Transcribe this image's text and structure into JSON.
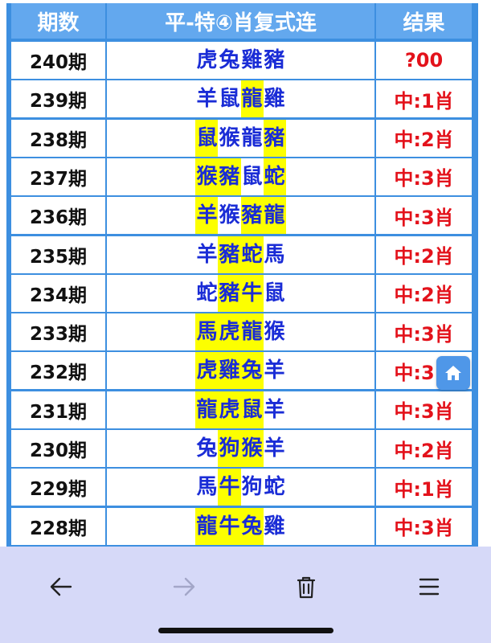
{
  "header": {
    "col_period": "期数",
    "col_zodiac": "平-特④肖复式连",
    "col_result": "结果"
  },
  "rows": [
    {
      "period": "240期",
      "zodiac": [
        "虎",
        "兔",
        "雞",
        "豬"
      ],
      "highlight": [
        false,
        false,
        false,
        false
      ],
      "result": "?00"
    },
    {
      "period": "239期",
      "zodiac": [
        "羊",
        "鼠",
        "龍",
        "雞"
      ],
      "highlight": [
        false,
        false,
        true,
        false
      ],
      "result": "中:1肖"
    },
    {
      "period": "238期",
      "zodiac": [
        "鼠",
        "猴",
        "龍",
        "豬"
      ],
      "highlight": [
        true,
        false,
        false,
        true
      ],
      "result": "中:2肖"
    },
    {
      "period": "237期",
      "zodiac": [
        "猴",
        "豬",
        "鼠",
        "蛇"
      ],
      "highlight": [
        true,
        true,
        false,
        true
      ],
      "result": "中:3肖"
    },
    {
      "period": "236期",
      "zodiac": [
        "羊",
        "猴",
        "豬",
        "龍"
      ],
      "highlight": [
        true,
        false,
        true,
        true
      ],
      "result": "中:3肖"
    },
    {
      "period": "235期",
      "zodiac": [
        "羊",
        "豬",
        "蛇",
        "馬"
      ],
      "highlight": [
        false,
        true,
        true,
        false
      ],
      "result": "中:2肖"
    },
    {
      "period": "234期",
      "zodiac": [
        "蛇",
        "豬",
        "牛",
        "鼠"
      ],
      "highlight": [
        false,
        true,
        true,
        false
      ],
      "result": "中:2肖"
    },
    {
      "period": "233期",
      "zodiac": [
        "馬",
        "虎",
        "龍",
        "猴"
      ],
      "highlight": [
        true,
        true,
        true,
        false
      ],
      "result": "中:3肖"
    },
    {
      "period": "232期",
      "zodiac": [
        "虎",
        "雞",
        "兔",
        "羊"
      ],
      "highlight": [
        true,
        true,
        true,
        false
      ],
      "result": "中:3肖"
    },
    {
      "period": "231期",
      "zodiac": [
        "龍",
        "虎",
        "鼠",
        "羊"
      ],
      "highlight": [
        true,
        true,
        true,
        false
      ],
      "result": "中:3肖"
    },
    {
      "period": "230期",
      "zodiac": [
        "兔",
        "狗",
        "猴",
        "羊"
      ],
      "highlight": [
        false,
        true,
        true,
        false
      ],
      "result": "中:2肖"
    },
    {
      "period": "229期",
      "zodiac": [
        "馬",
        "牛",
        "狗",
        "蛇"
      ],
      "highlight": [
        false,
        true,
        false,
        false
      ],
      "result": "中:1肖"
    },
    {
      "period": "228期",
      "zodiac": [
        "龍",
        "牛",
        "兔",
        "雞"
      ],
      "highlight": [
        true,
        true,
        true,
        false
      ],
      "result": "中:3肖"
    }
  ],
  "colors": {
    "table_border": "#3d8fe0",
    "header_bg": "#63a8ee",
    "zodiac_text": "#1a2cd6",
    "highlight": "#fcff00",
    "result_text": "#e3121b",
    "toolbar_bg": "#d6d9f8"
  },
  "icons": {
    "home": "home-icon",
    "back": "arrow-left-icon",
    "forward": "arrow-right-icon",
    "delete": "trash-icon",
    "menu": "menu-icon"
  }
}
